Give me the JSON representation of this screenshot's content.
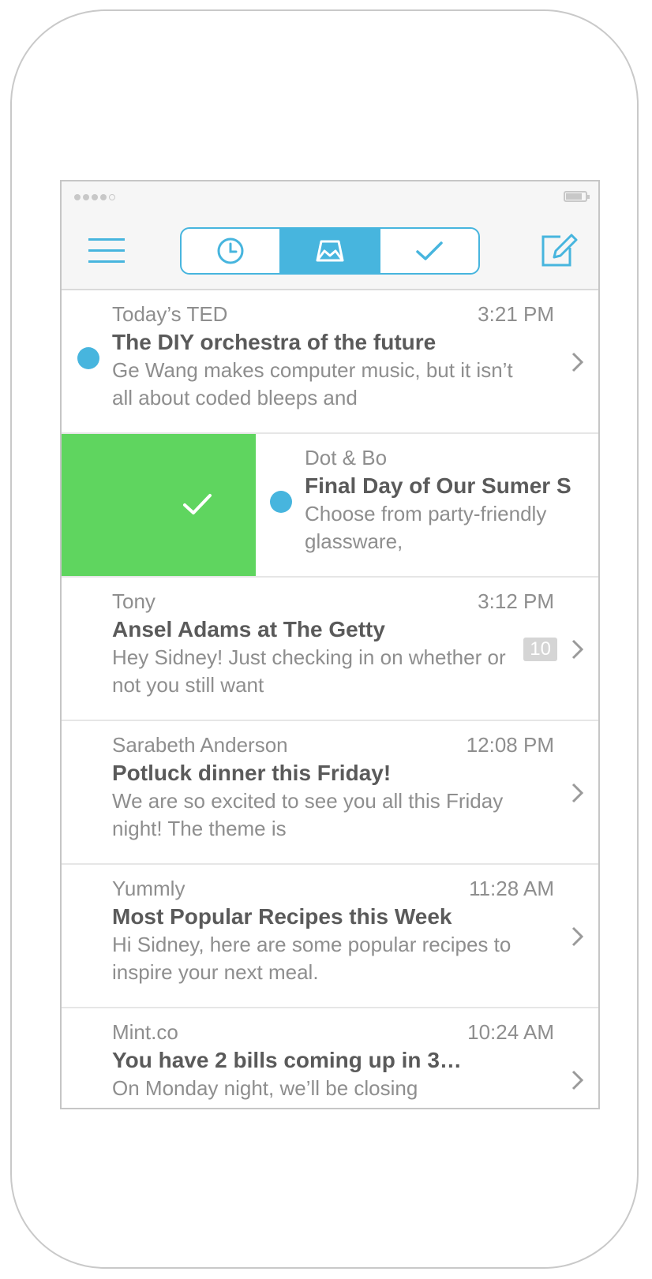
{
  "status_bar": {
    "signal_icon": "signal-dots-icon",
    "battery_icon": "battery-icon"
  },
  "header": {
    "menu_icon": "hamburger-menu-icon",
    "compose_icon": "compose-icon",
    "tabs": [
      {
        "name": "later",
        "icon": "clock-icon",
        "active": false
      },
      {
        "name": "inbox",
        "icon": "inbox-tray-icon",
        "active": true
      },
      {
        "name": "done",
        "icon": "checkmark-icon",
        "active": false
      }
    ]
  },
  "colors": {
    "accent": "#47b5de",
    "swipe_done": "#5fd55f",
    "header_bg": "#f6f6f6",
    "text_primary": "#5a5a5a",
    "text_secondary": "#8e8e8e"
  },
  "emails": [
    {
      "sender": "Today’s TED",
      "time": "3:21 PM",
      "subject": "The DIY orchestra of the future",
      "preview": "Ge Wang makes computer music, but it isn’t all about coded bleeps and",
      "unread": true
    },
    {
      "sender": "Dot & Bo",
      "subject": "Final Day of Our Sumer S",
      "preview": "Choose from party-friendly glassware,",
      "unread": true,
      "swiped": true,
      "swipe_icon": "checkmark-icon"
    },
    {
      "sender": "Tony",
      "time": "3:12 PM",
      "subject": "Ansel Adams at The Getty",
      "preview": "Hey Sidney! Just checking in on whether or not you still want",
      "count": "10"
    },
    {
      "sender": "Sarabeth Anderson",
      "time": "12:08 PM",
      "subject": "Potluck dinner this Friday!",
      "preview": "We are so excited to see you all this Friday night! The theme is"
    },
    {
      "sender": "Yummly",
      "time": "11:28 AM",
      "subject": "Most Popular Recipes this Week",
      "preview": "Hi Sidney, here are some popular recipes to inspire your next meal."
    },
    {
      "sender": "Mint.co",
      "time": "10:24 AM",
      "subject": "You have 2 bills coming up in 3…",
      "preview": "On Monday night, we’ll be closing"
    }
  ]
}
